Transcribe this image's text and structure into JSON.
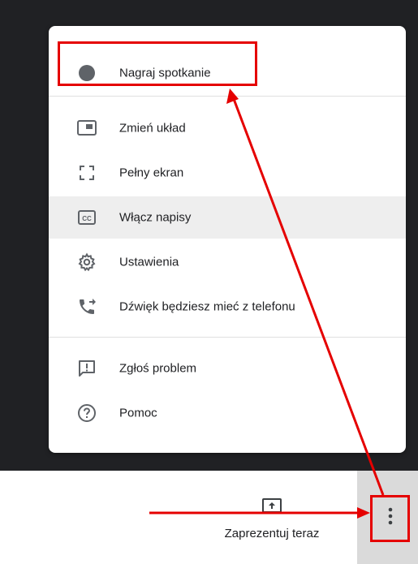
{
  "menu": {
    "items": [
      {
        "label": "Nagraj spotkanie",
        "icon": "record-dot-icon"
      },
      {
        "label": "Zmień układ",
        "icon": "layout-icon"
      },
      {
        "label": "Pełny ekran",
        "icon": "fullscreen-icon"
      },
      {
        "label": "Włącz napisy",
        "icon": "closed-captions-icon"
      },
      {
        "label": "Ustawienia",
        "icon": "settings-gear-icon"
      },
      {
        "label": "Dźwięk będziesz mieć z telefonu",
        "icon": "phone-forward-icon"
      },
      {
        "label": "Zgłoś problem",
        "icon": "report-problem-icon"
      },
      {
        "label": "Pomoc",
        "icon": "help-icon"
      }
    ],
    "highlighted_item": "Włącz napisy"
  },
  "toolbar": {
    "present_label": "Zaprezentuj teraz",
    "present_icon": "present-screen-icon",
    "more_icon": "more-vert-icon"
  },
  "annotations": {
    "color": "#e50000",
    "highlighted": [
      "Nagraj spotkanie",
      "more-vert-icon"
    ]
  }
}
